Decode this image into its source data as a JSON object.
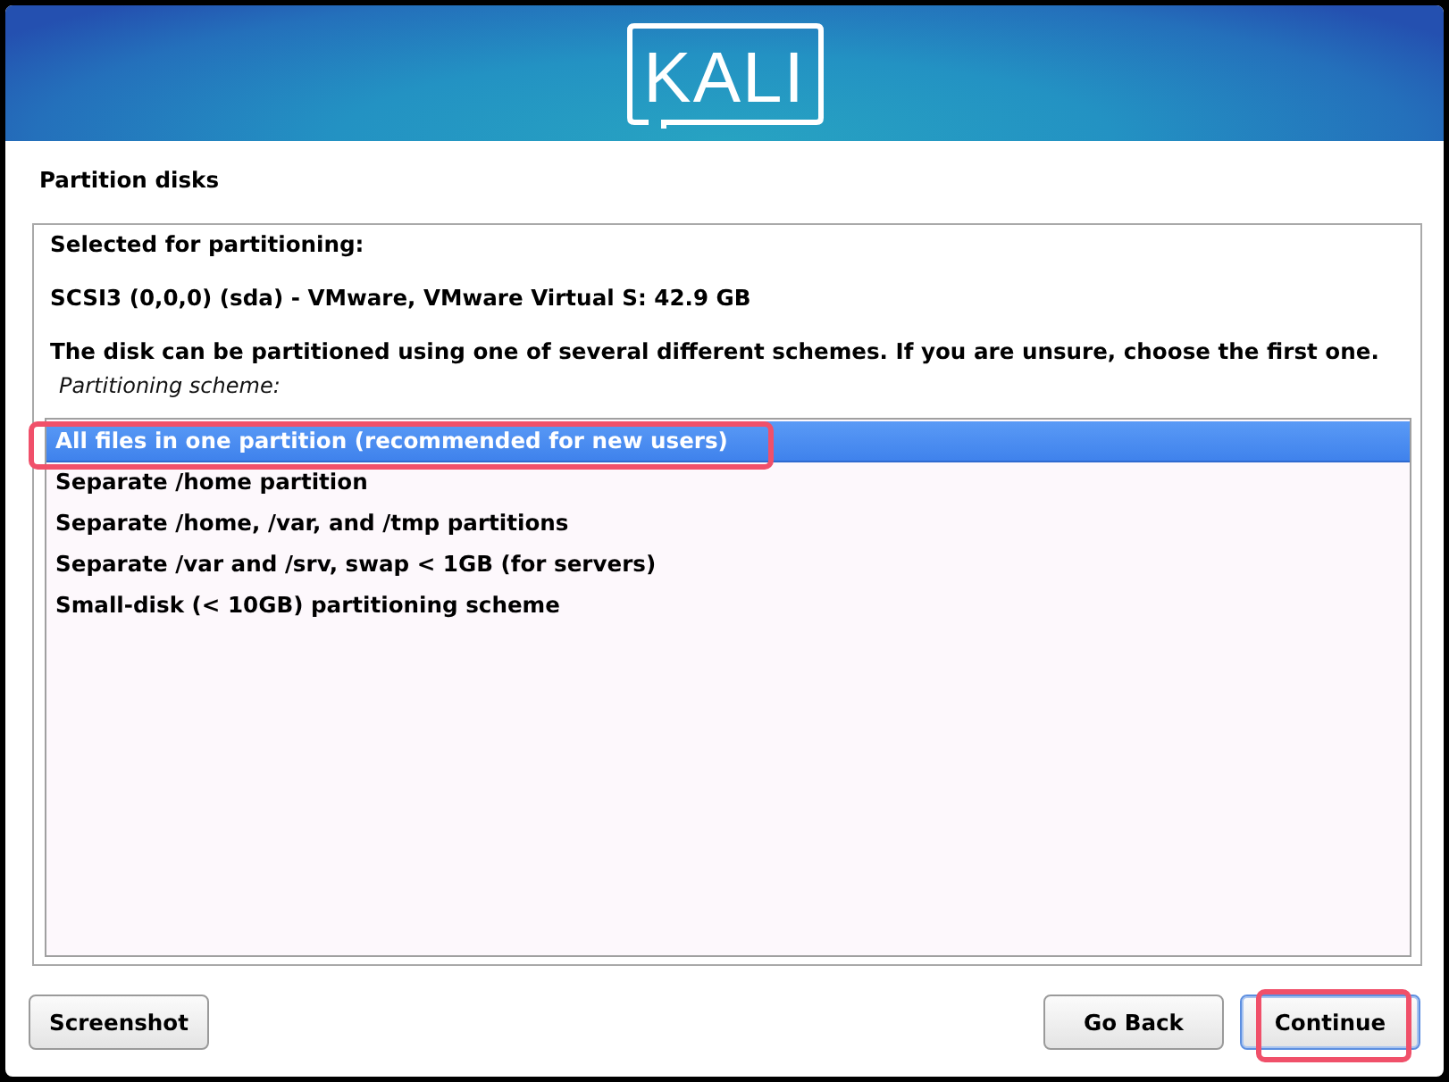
{
  "header": {
    "logo": "KALI"
  },
  "page_title": "Partition disks",
  "panel": {
    "lines": [
      "Selected for partitioning:",
      "SCSI3 (0,0,0) (sda) - VMware, VMware Virtual S: 42.9 GB",
      "The disk can be partitioned using one of several different schemes. If you are unsure, choose the first one."
    ],
    "list_label": "Partitioning scheme:",
    "options": [
      {
        "label": "All files in one partition (recommended for new users)",
        "selected": true,
        "highlighted": true
      },
      {
        "label": "Separate /home partition",
        "selected": false,
        "highlighted": false
      },
      {
        "label": "Separate /home, /var, and /tmp partitions",
        "selected": false,
        "highlighted": false
      },
      {
        "label": "Separate /var and /srv, swap < 1GB (for servers)",
        "selected": false,
        "highlighted": false
      },
      {
        "label": "Small-disk (< 10GB) partitioning scheme",
        "selected": false,
        "highlighted": false
      }
    ]
  },
  "buttons_left": [
    {
      "label": "Screenshot",
      "default": false,
      "highlighted": false
    }
  ],
  "buttons_right": [
    {
      "label": "Go Back",
      "default": false,
      "highlighted": false
    },
    {
      "label": "Continue",
      "default": true,
      "highlighted": true
    }
  ]
}
